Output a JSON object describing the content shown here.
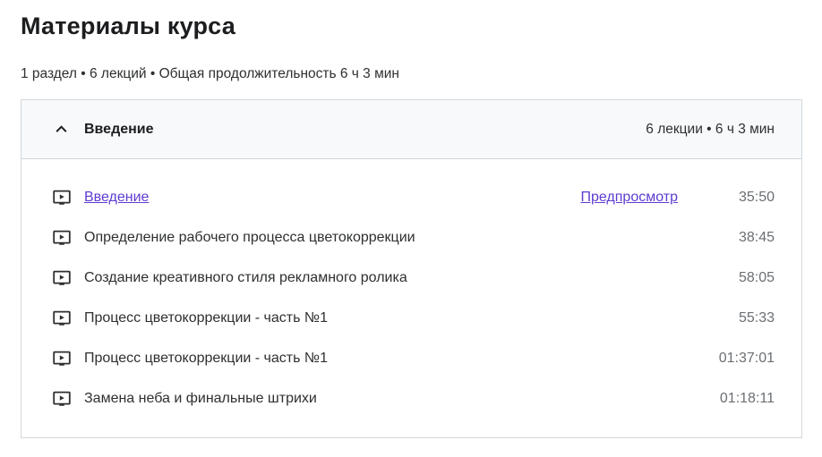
{
  "page": {
    "title": "Материалы курса",
    "summary": "1 раздел • 6 лекций • Общая продолжительность 6 ч 3 мин"
  },
  "section": {
    "title": "Введение",
    "meta": "6 лекции • 6 ч 3 мин",
    "expanded": true,
    "chevron_icon": "chevron-up"
  },
  "lectures": [
    {
      "icon": "video-lecture-icon",
      "title": "Введение",
      "is_link": true,
      "preview_label": "Предпросмотр",
      "duration": "35:50"
    },
    {
      "icon": "video-lecture-icon",
      "title": "Определение рабочего процесса цветокоррекции",
      "is_link": false,
      "duration": "38:45"
    },
    {
      "icon": "video-lecture-icon",
      "title": "Создание креативного стиля рекламного ролика",
      "is_link": false,
      "duration": "58:05"
    },
    {
      "icon": "video-lecture-icon",
      "title": "Процесс цветокоррекции - часть №1",
      "is_link": false,
      "duration": "55:33"
    },
    {
      "icon": "video-lecture-icon",
      "title": "Процесс цветокоррекции - часть №1",
      "is_link": false,
      "duration": "01:37:01"
    },
    {
      "icon": "video-lecture-icon",
      "title": "Замена неба и финальные штрихи",
      "is_link": false,
      "duration": "01:18:11"
    }
  ],
  "colors": {
    "panel_border": "#d1d7dc",
    "header_bg": "#f7f9fa",
    "text_dark": "#1c1d1f",
    "text_body": "#2d2f31",
    "text_muted": "#6a6f73",
    "link_purple": "#5e3bd1"
  }
}
